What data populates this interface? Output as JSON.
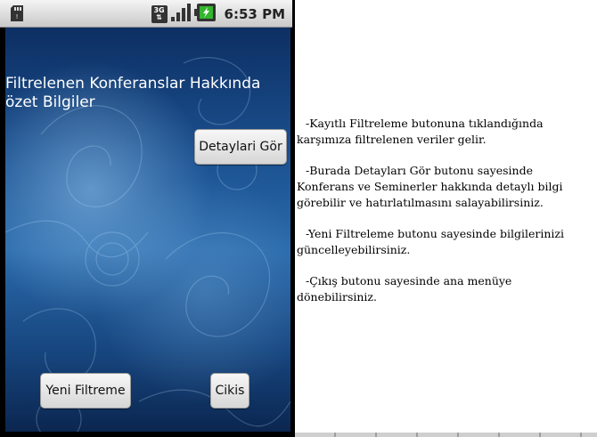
{
  "statusbar": {
    "time": "6:53 PM",
    "network": "3G",
    "icons": [
      "sd-card-icon",
      "network-3g-icon",
      "signal-icon",
      "battery-icon"
    ]
  },
  "screen": {
    "title": "Filtrelenen Konferanslar Hakkında özet Bilgiler",
    "buttons": {
      "details": "Detaylari Gör",
      "new_filter": "Yeni Filtreme",
      "exit": "Cikis"
    }
  },
  "help": {
    "paragraphs": [
      "-Kayıtlı Filtreleme butonuna tıklandığında karşımıza filtrelenen veriler gelir.",
      "-Burada Detayları Gör butonu sayesinde Konferans ve Seminerler hakkında detaylı bilgi görebilir ve hatırlatılmasını salayabilirsiniz.",
      "-Yeni Filtreleme butonu sayesinde bilgilerinizi güncelleyebilirsiniz.",
      "-Çıkış butonu sayesinde ana menüye dönebilirsiniz."
    ]
  },
  "colors": {
    "background_top": "#0d2f63",
    "background_mid": "#2a6aab",
    "battery_green": "#33b52e"
  }
}
